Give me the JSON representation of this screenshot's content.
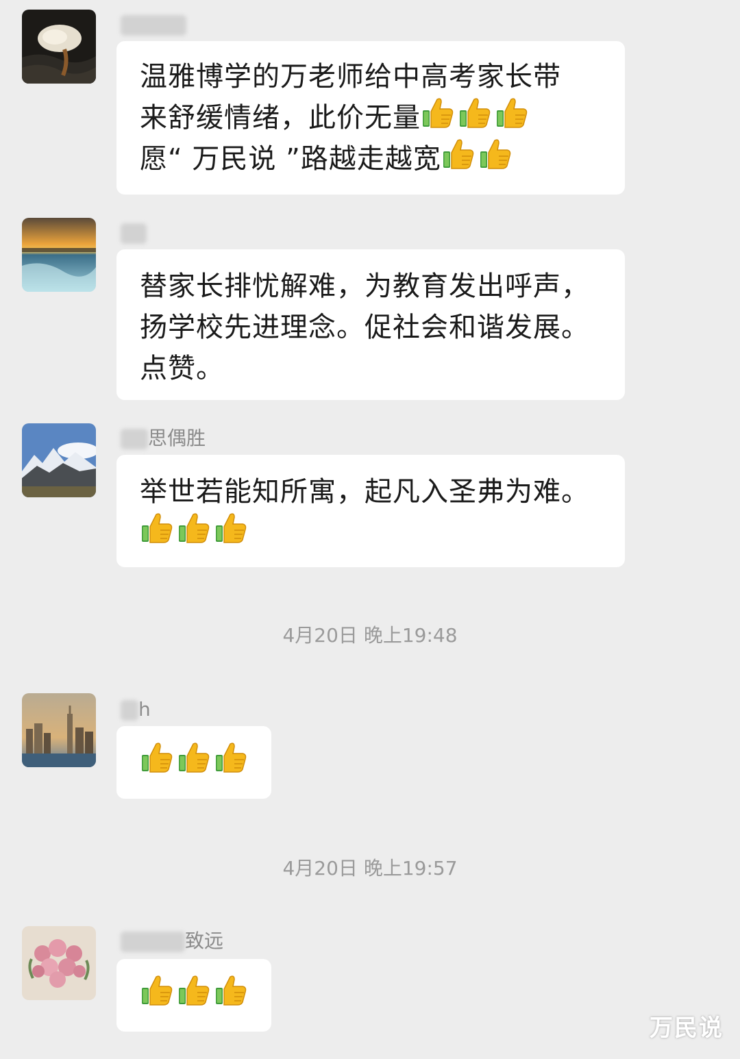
{
  "chat": {
    "messages": [
      {
        "sender": "",
        "avatar": "nautilus-shell-avatar",
        "lines": [
          {
            "text": "温雅博学的万老师给中高考家长带",
            "thumbs": 0
          },
          {
            "text": "来舒缓情绪，此价无量",
            "thumbs": 3
          },
          {
            "text": "愿“ 万民说 ”路越走越宽",
            "thumbs": 2
          }
        ]
      },
      {
        "sender": "",
        "avatar": "sunset-lake-avatar",
        "lines": [
          {
            "text": "替家长排忧解难，为教育发出呼声，",
            "thumbs": 0
          },
          {
            "text": "扬学校先进理念。促社会和谐发展。",
            "thumbs": 0
          },
          {
            "text": "点赞。",
            "thumbs": 0
          }
        ]
      },
      {
        "sender": "思偶胜",
        "avatar": "snow-mountain-avatar",
        "lines": [
          {
            "text": "举世若能知所寓，起凡入圣弗为难。",
            "thumbs": 0
          },
          {
            "text": "",
            "thumbs": 3
          }
        ]
      },
      {
        "sender": "h",
        "avatar": "city-skyline-avatar",
        "lines": [
          {
            "text": "",
            "thumbs": 3
          }
        ]
      },
      {
        "sender": "致远",
        "avatar": "rose-bouquet-avatar",
        "lines": [
          {
            "text": "",
            "thumbs": 3
          }
        ]
      }
    ],
    "timestamps": [
      "4月20日 晚上19:48",
      "4月20日 晚上19:57"
    ]
  },
  "emoji": {
    "name": "thumbs-up-icon"
  },
  "watermark": "万民说",
  "colors": {
    "background": "#ededed",
    "bubble": "#ffffff",
    "meta_text": "#9a9a9a"
  }
}
